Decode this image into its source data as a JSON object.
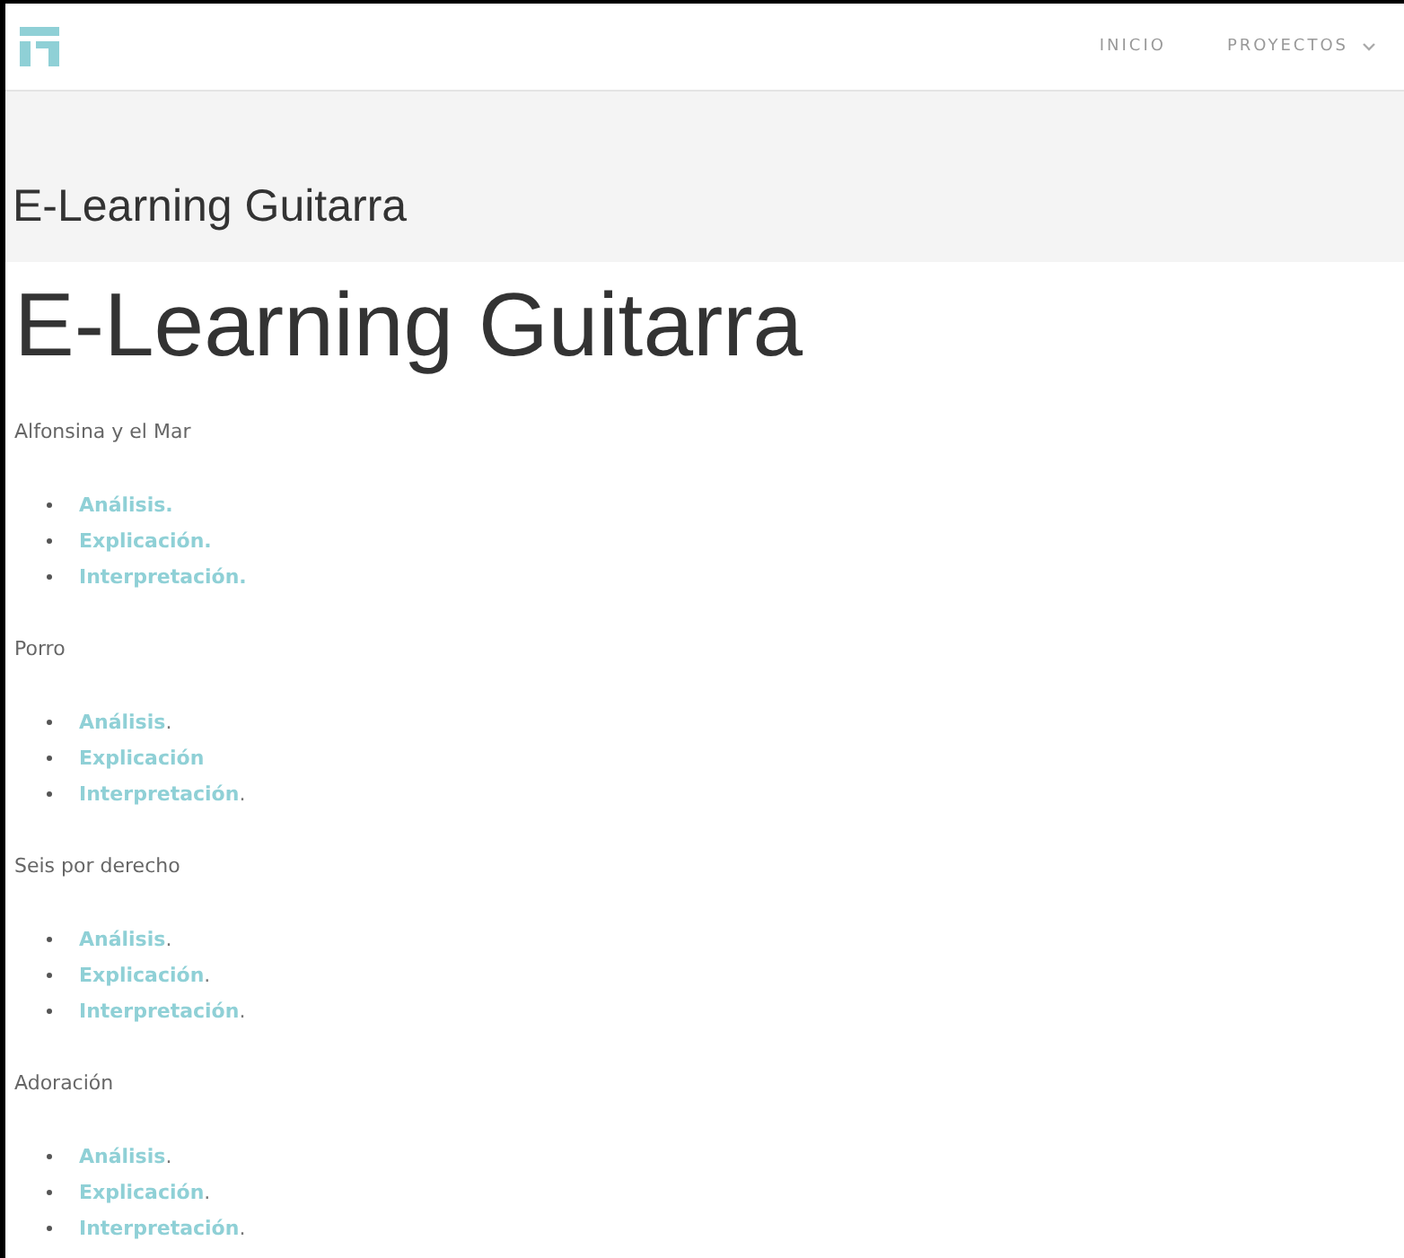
{
  "nav": {
    "items": [
      {
        "label": "INICIO",
        "dropdown": false
      },
      {
        "label": "PROYECTOS",
        "dropdown": true
      }
    ]
  },
  "banner": {
    "title": "E-Learning Guitarra"
  },
  "content": {
    "heading": "E-Learning Guitarra",
    "songs": [
      {
        "title": "Alfonsina y el Mar",
        "links": [
          {
            "text": "Análisis."
          },
          {
            "text": "Explicación."
          },
          {
            "text": "Interpretación."
          }
        ]
      },
      {
        "title": "Porro",
        "links": [
          {
            "text": "Análisis",
            "after": "."
          },
          {
            "text": "Explicación"
          },
          {
            "text": "Interpretación",
            "after": "."
          }
        ]
      },
      {
        "title": "Seis por derecho",
        "links": [
          {
            "text": "Análisis",
            "after": "."
          },
          {
            "text": "Explicación",
            "after": "."
          },
          {
            "text": "Interpretación",
            "after": "."
          }
        ]
      },
      {
        "title": "Adoración",
        "links": [
          {
            "text": "Análisis",
            "after": "."
          },
          {
            "text": "Explicación",
            "after": "."
          },
          {
            "text": "Interpretación",
            "after": "."
          }
        ]
      }
    ]
  }
}
